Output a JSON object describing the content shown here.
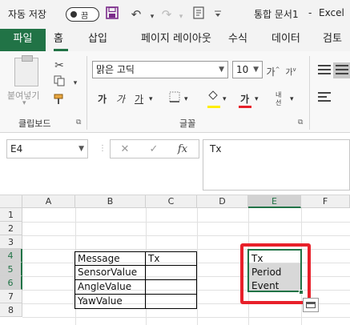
{
  "titlebar": {
    "autosave_label": "자동 저장",
    "autosave_state": "끔",
    "doc_name": "통합 문서1",
    "separator": "-",
    "app_name": "Excel"
  },
  "tabs": [
    "파일",
    "홈",
    "삽입",
    "페이지 레이아웃",
    "수식",
    "데이터",
    "검토"
  ],
  "ribbon": {
    "paste_label": "붙여넣기",
    "clipboard_group": "클립보드",
    "font_group": "글꼴",
    "font_name": "맑은 고딕",
    "font_size": "10",
    "bold": "가",
    "italic": "가",
    "underline": "가",
    "font_color_glyph": "가",
    "grow_font": "가",
    "shrink_font": "가",
    "phonetic": "내선",
    "highlight_color": "#ffee00",
    "font_color": "#e8202a"
  },
  "formula_bar": {
    "name_box": "E4",
    "fx_label": "fx",
    "content": "Tx"
  },
  "grid": {
    "columns": [
      "A",
      "B",
      "C",
      "D",
      "E",
      "F"
    ],
    "rows": [
      "1",
      "2",
      "3",
      "4",
      "5",
      "6",
      "7",
      "8"
    ],
    "selected_column": "E",
    "cells": {
      "B4": "Message",
      "C4": "Tx",
      "B5": "SensorValue",
      "B6": "AngleValue",
      "B7": "YawValue",
      "E4": "Tx",
      "E5": "Period",
      "E6": "Event"
    }
  },
  "colors": {
    "accent": "#217346",
    "highlight_red": "#e8202a"
  }
}
